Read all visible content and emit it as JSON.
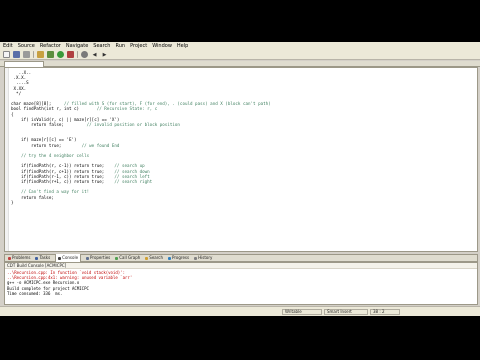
{
  "menubar": {
    "items": [
      "Edit",
      "Source",
      "Refactor",
      "Navigate",
      "Search",
      "Run",
      "Project",
      "Window",
      "Help"
    ]
  },
  "toolbar": {
    "icons": [
      "new-icon",
      "save-icon",
      "print-icon",
      "build-icon",
      "debug-icon",
      "run-icon",
      "external-tools-icon",
      "search-icon",
      "back-icon",
      "forward-icon"
    ]
  },
  "editor": {
    "lines": [
      "   ..X..",
      " .X.X.",
      "  ....S",
      " X.XX.",
      "  */",
      "",
      "char maze[8][8];     // filled with S (for start), F (for end), . (could pass) and X (block can't path)",
      "bool findPath(int r, int c)       // Recursive State: r, c",
      "{",
      "    if( isValid(r, c) || maze[r][c] == 'X')",
      "        return false;         // invalid position or block position",
      "",
      "",
      "    if( maze[r][c] == 'E')",
      "        return true;        // we found End",
      "",
      "    // try the 4 neighbor cells",
      "",
      "    if(findPath(r, c-1)) return true;    // search up",
      "    if(findPath(r, c+1)) return true;    // search down",
      "    if(findPath(r-1, c)) return true;    // search left",
      "    if(findPath(r+1, c)) return true;    // search right",
      "",
      "    // Can't find a way for it!",
      "    return false;",
      "}"
    ]
  },
  "panel": {
    "tabs": [
      "Problems",
      "Tasks",
      "Console",
      "Properties",
      "Call Graph",
      "Search",
      "Progress",
      "History"
    ],
    "active_tab": "Console",
    "console_title": "CDT Build Console [ACMICPC]",
    "console_lines": [
      "..\\Recursion.cpp: In function `void stack(void)':",
      "..\\Recursion.cpp:4x1: warning: unused variable `arr'",
      "g++ -o ACMICPC.exe Recursion.o",
      "Build complete for project ACMICPC",
      "Time consumed: 336  ms."
    ]
  },
  "statusbar": {
    "writable": "Writable",
    "insert_mode": "Smart Insert",
    "position": "38 : 2"
  }
}
